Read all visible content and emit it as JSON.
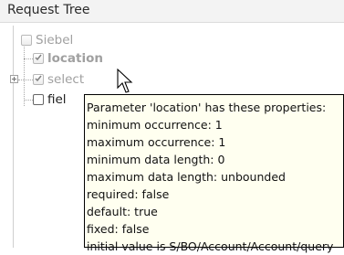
{
  "panel": {
    "title": "Request Tree"
  },
  "tree": {
    "items": [
      {
        "label": "Siebel",
        "checked": false,
        "enabled": false
      },
      {
        "label": "location",
        "checked": true,
        "enabled": false
      },
      {
        "label": "select",
        "checked": true,
        "enabled": false,
        "expandable": true
      },
      {
        "label": "fiel",
        "checked": false,
        "enabled": true
      }
    ]
  },
  "tooltip": {
    "lines": [
      "Parameter 'location' has these properties:",
      "minimum occurrence: 1",
      "maximum occurrence: 1",
      "minimum data length: 0",
      "maximum data length: unbounded",
      "required: false",
      "default: true",
      "fixed: false",
      "initial value is S/BO/Account/Account/query"
    ]
  },
  "colors": {
    "tooltip_background": "#fffff0",
    "disabled_text": "#a0a0a0",
    "header_background": "#f3f3f3"
  }
}
